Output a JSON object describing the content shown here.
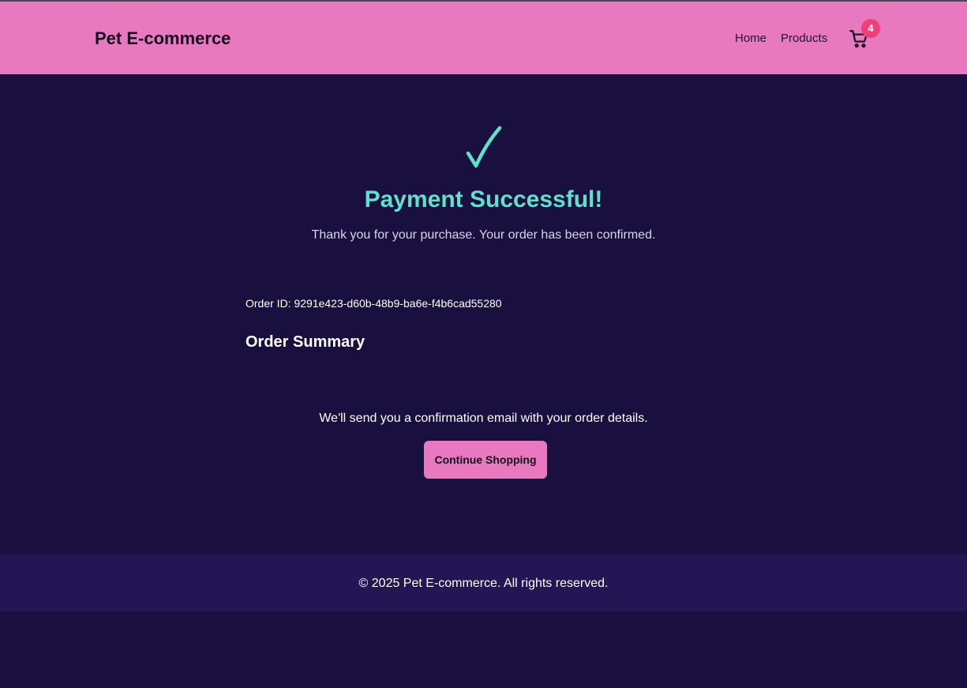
{
  "header": {
    "brand": "Pet E-commerce",
    "nav": {
      "home": "Home",
      "products": "Products"
    },
    "cart": {
      "icon": "cart-icon",
      "count": "4"
    }
  },
  "main": {
    "check_icon": "checkmark-icon",
    "title": "Payment Successful!",
    "subtitle": "Thank you for your purchase. Your order has been confirmed.",
    "order_id_text": "Order ID: 9291e423-d60b-48b9-ba6e-f4b6cad55280",
    "summary_heading": "Order Summary",
    "confirmation_text": "We'll send you a confirmation email with your order details.",
    "continue_label": "Continue Shopping"
  },
  "footer": {
    "text": "© 2025 Pet E-commerce. All rights reserved."
  },
  "colors": {
    "background": "#1a1040",
    "header": "#e879bf",
    "accent": "#5fe0c9",
    "badge": "#f0407a",
    "footer": "#241654"
  }
}
